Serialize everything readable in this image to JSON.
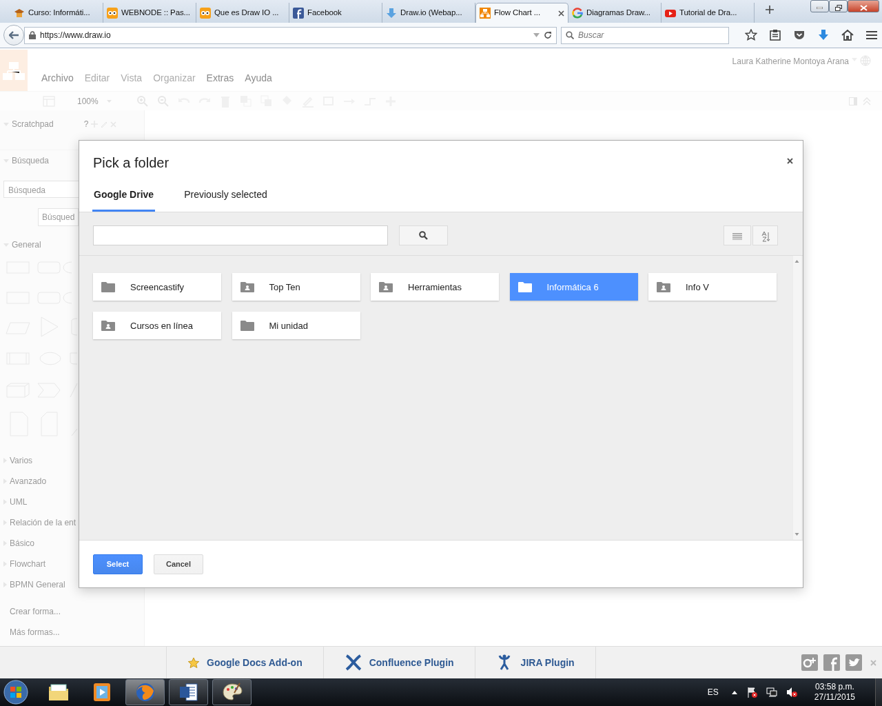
{
  "browser": {
    "tabs": [
      {
        "label": "Curso: Informáti...",
        "kind": "cap",
        "selected": false
      },
      {
        "label": "WEBNODE :: Pas...",
        "kind": "owl",
        "selected": false
      },
      {
        "label": "Que es Draw IO ...",
        "kind": "owl",
        "selected": false
      },
      {
        "label": "Facebook",
        "kind": "facebook",
        "selected": false
      },
      {
        "label": "Draw.io (Webap...",
        "kind": "download",
        "selected": false
      },
      {
        "label": "Flow Chart ...",
        "kind": "diagram",
        "selected": true
      },
      {
        "label": "Diagramas Draw...",
        "kind": "google",
        "selected": false
      },
      {
        "label": "Tutorial de Dra...",
        "kind": "video",
        "selected": false
      }
    ],
    "url": "https://www.draw.io",
    "search_placeholder": "Buscar"
  },
  "app": {
    "menu": [
      {
        "label": "Archivo",
        "disabled": false
      },
      {
        "label": "Editar",
        "disabled": true
      },
      {
        "label": "Vista",
        "disabled": true
      },
      {
        "label": "Organizar",
        "disabled": true
      },
      {
        "label": "Extras",
        "disabled": false
      },
      {
        "label": "Ayuda",
        "disabled": false
      }
    ],
    "user": "Laura Katherine Montoya Arana",
    "zoom": "100%",
    "sidebar": {
      "sections": [
        {
          "title": "Scratchpad",
          "expanded": true,
          "kind": "scratchpad",
          "help": "?"
        },
        {
          "title": "Búsqueda",
          "expanded": true,
          "kind": "search",
          "placeholder": "Búsqueda",
          "button": "Búsqued"
        },
        {
          "title": "General",
          "expanded": true,
          "kind": "shapes"
        },
        {
          "title": "Varios",
          "expanded": false
        },
        {
          "title": "Avanzado",
          "expanded": false
        },
        {
          "title": "UML",
          "expanded": false
        },
        {
          "title": "Relación de la ent",
          "expanded": false
        },
        {
          "title": "Básico",
          "expanded": false
        },
        {
          "title": "Flowchart",
          "expanded": false
        },
        {
          "title": "BPMN General",
          "expanded": false
        }
      ],
      "links": [
        "Crear forma...",
        "Más formas..."
      ]
    }
  },
  "dialog": {
    "title": "Pick a folder",
    "tabs": [
      {
        "label": "Google Drive",
        "selected": true
      },
      {
        "label": "Previously selected",
        "selected": false
      }
    ],
    "folders": [
      {
        "name": "Screencastify",
        "kind": "folder",
        "selected": false
      },
      {
        "name": "Top Ten",
        "kind": "shared",
        "selected": false
      },
      {
        "name": "Herramientas",
        "kind": "shared",
        "selected": false
      },
      {
        "name": "Informática 6",
        "kind": "folder",
        "selected": true
      },
      {
        "name": "Info V",
        "kind": "shared",
        "selected": false
      },
      {
        "name": "Cursos en línea",
        "kind": "shared",
        "selected": false
      },
      {
        "name": "Mi unidad",
        "kind": "folder",
        "selected": false
      }
    ],
    "buttons": [
      {
        "label": "Select",
        "kind": "primary"
      },
      {
        "label": "Cancel",
        "kind": "secondary"
      }
    ]
  },
  "footer": {
    "links": [
      {
        "label": "Google Docs Add-on",
        "kind": "star"
      },
      {
        "label": "Confluence Plugin",
        "kind": "confluence"
      },
      {
        "label": "JIRA Plugin",
        "kind": "jira"
      }
    ]
  },
  "taskbar": {
    "apps": [
      {
        "kind": "folder",
        "running": false,
        "selected": false
      },
      {
        "kind": "media",
        "running": false,
        "selected": false
      },
      {
        "kind": "browser",
        "running": true,
        "selected": true
      },
      {
        "kind": "document",
        "running": true,
        "selected": false
      },
      {
        "kind": "palette",
        "running": true,
        "selected": false
      }
    ],
    "language": "ES",
    "time": "03:58 p.m.",
    "date": "27/11/2015"
  }
}
